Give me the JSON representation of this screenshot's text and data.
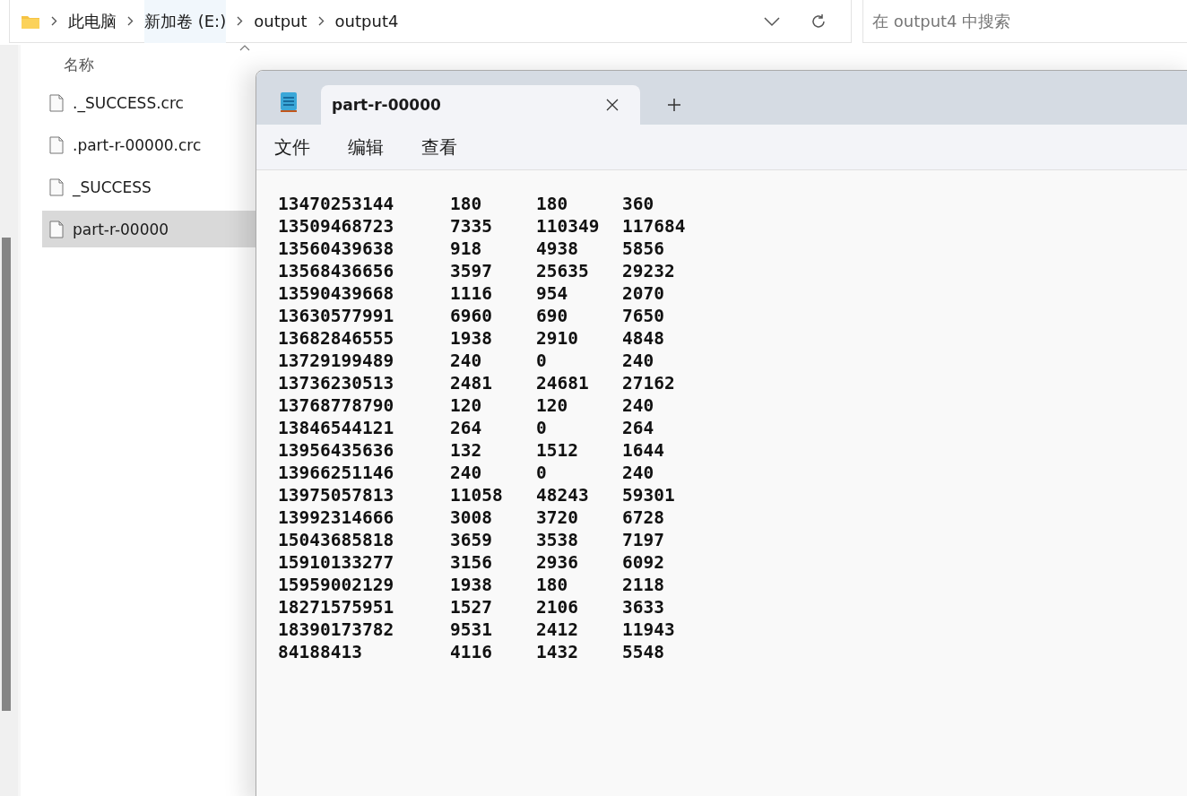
{
  "explorer": {
    "breadcrumb": [
      "此电脑",
      "新加卷 (E:)",
      "output",
      "output4"
    ],
    "search": {
      "placeholder": "在 output4 中搜索"
    },
    "column_header": "名称",
    "files": [
      {
        "name": "._SUCCESS.crc",
        "selected": false
      },
      {
        "name": ".part-r-00000.crc",
        "selected": false
      },
      {
        "name": "_SUCCESS",
        "selected": false
      },
      {
        "name": "part-r-00000",
        "selected": true
      }
    ]
  },
  "notepad": {
    "tabs": [
      {
        "label": "part-r-00000",
        "selected": true
      }
    ],
    "menu": [
      "文件",
      "编辑",
      "查看"
    ],
    "rows": [
      [
        "13470253144",
        "180",
        "180",
        "360"
      ],
      [
        "13509468723",
        "7335",
        "110349",
        "117684"
      ],
      [
        "13560439638",
        "918",
        "4938",
        "5856"
      ],
      [
        "13568436656",
        "3597",
        "25635",
        "29232"
      ],
      [
        "13590439668",
        "1116",
        "954",
        "2070"
      ],
      [
        "13630577991",
        "6960",
        "690",
        "7650"
      ],
      [
        "13682846555",
        "1938",
        "2910",
        "4848"
      ],
      [
        "13729199489",
        "240",
        "0",
        "240"
      ],
      [
        "13736230513",
        "2481",
        "24681",
        "27162"
      ],
      [
        "13768778790",
        "120",
        "120",
        "240"
      ],
      [
        "13846544121",
        "264",
        "0",
        "264"
      ],
      [
        "13956435636",
        "132",
        "1512",
        "1644"
      ],
      [
        "13966251146",
        "240",
        "0",
        "240"
      ],
      [
        "13975057813",
        "11058",
        "48243",
        "59301"
      ],
      [
        "13992314666",
        "3008",
        "3720",
        "6728"
      ],
      [
        "15043685818",
        "3659",
        "3538",
        "7197"
      ],
      [
        "15910133277",
        "3156",
        "2936",
        "6092"
      ],
      [
        "15959002129",
        "1938",
        "180",
        "2118"
      ],
      [
        "18271575951",
        "1527",
        "2106",
        "3633"
      ],
      [
        "18390173782",
        "9531",
        "2412",
        "11943"
      ],
      [
        "84188413",
        "4116",
        "1432",
        "5548"
      ]
    ]
  }
}
